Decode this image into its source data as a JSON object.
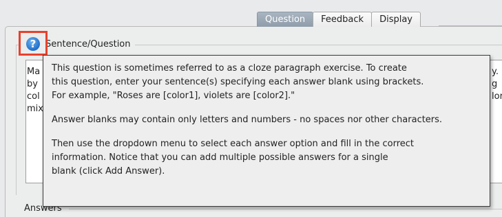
{
  "tabs": [
    {
      "label": "Question",
      "active": true
    },
    {
      "label": "Feedback",
      "active": false
    },
    {
      "label": "Display",
      "active": false
    }
  ],
  "sentence_section": {
    "legend": "Sentence/Question",
    "help_icon": "question-mark-icon",
    "textarea_fragments_left": [
      "Ma",
      "by",
      "col",
      "mix"
    ],
    "textarea_fragments_right": [
      "y. F",
      "g",
      "lor"
    ]
  },
  "answers_section": {
    "legend": "Answers"
  },
  "tooltip": {
    "lines_p1": [
      "This question is sometimes referred to as a cloze paragraph exercise. To create",
      "this question, enter your sentence(s) specifying each answer blank using brackets.",
      "For example, \"Roses are [color1], violets are [color2].\""
    ],
    "line_p2": "Answer blanks may contain only letters and numbers - no spaces nor other characters.",
    "lines_p3": [
      "Then use the dropdown menu to select each answer option and fill in the correct",
      "information. Notice that you can add multiple possible answers for a single",
      "blank (click Add Answer)."
    ]
  },
  "colors": {
    "highlight_border": "#e8412c",
    "active_tab": "#9aa7b4",
    "help_icon": "#1f6fc9"
  }
}
